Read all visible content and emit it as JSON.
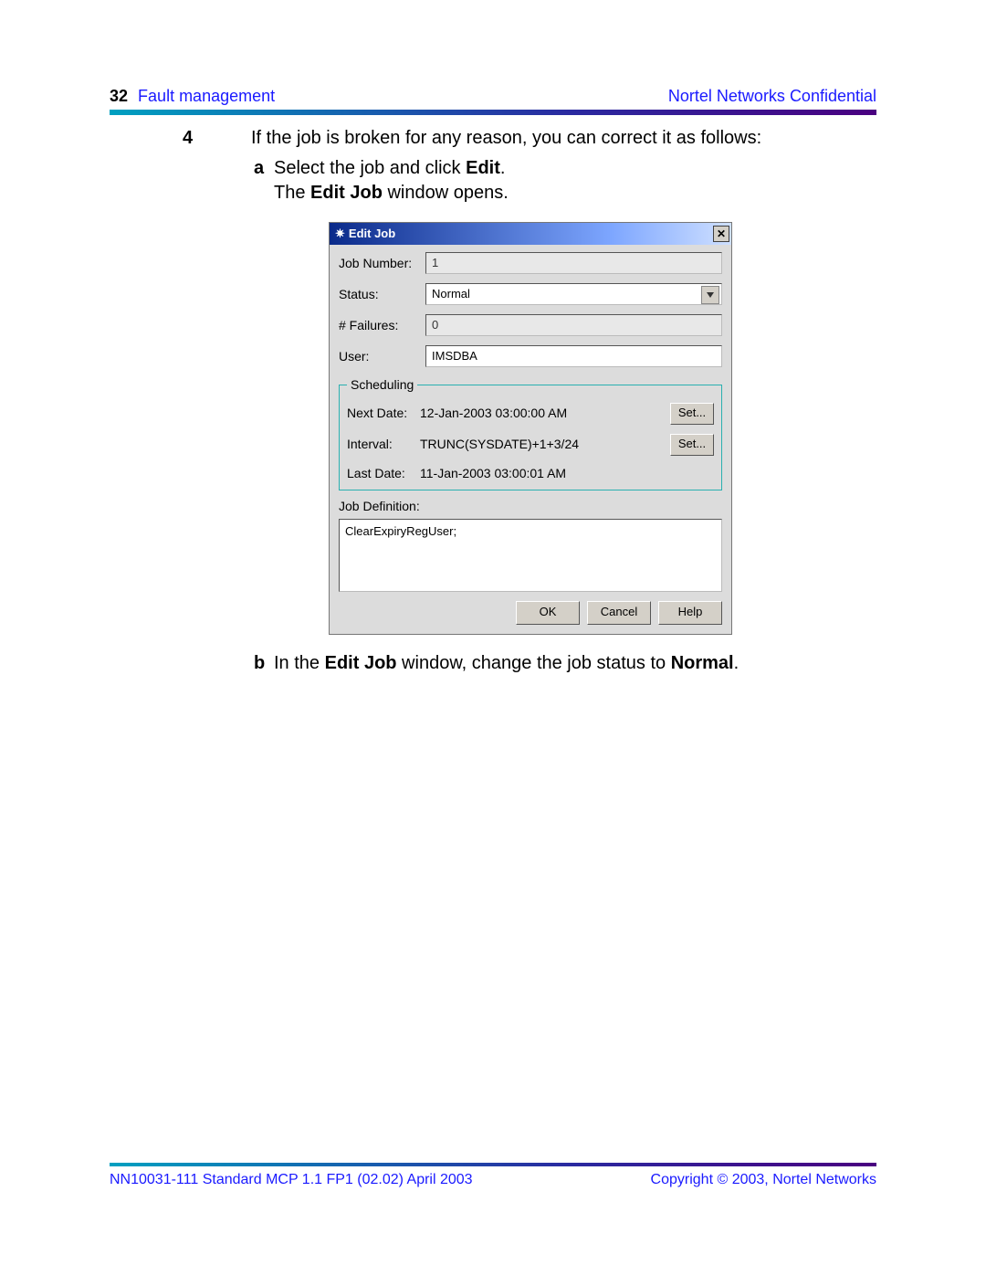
{
  "header": {
    "page_number": "32",
    "section": "Fault management",
    "confidential": "Nortel Networks Confidential"
  },
  "step": {
    "number": "4",
    "intro": "If the job is broken for any reason, you can correct it as follows:",
    "a_prefix": "a",
    "a_text_pre": "Select the job and click ",
    "a_bold": "Edit",
    "a_text_post": ".",
    "a_line2_pre": "The ",
    "a_line2_bold": "Edit Job",
    "a_line2_post": " window opens.",
    "b_prefix": "b",
    "b_text_pre": "In the ",
    "b_bold1": "Edit Job",
    "b_text_mid": " window, change the job status to ",
    "b_bold2": "Normal",
    "b_text_post": "."
  },
  "dialog": {
    "title": "Edit Job",
    "labels": {
      "job_number": "Job Number:",
      "status": "Status:",
      "failures": "# Failures:",
      "user": "User:",
      "scheduling": "Scheduling",
      "next_date": "Next Date:",
      "interval": "Interval:",
      "last_date": "Last Date:",
      "job_definition": "Job Definition:"
    },
    "values": {
      "job_number": "1",
      "status": "Normal",
      "failures": "0",
      "user": "IMSDBA",
      "next_date": "12-Jan-2003 03:00:00 AM",
      "interval": "TRUNC(SYSDATE)+1+3/24",
      "last_date": "11-Jan-2003 03:00:01 AM",
      "job_definition": "ClearExpiryRegUser;"
    },
    "buttons": {
      "set": "Set...",
      "ok": "OK",
      "cancel": "Cancel",
      "help": "Help"
    }
  },
  "footer": {
    "left": "NN10031-111   Standard   MCP 1.1 FP1 (02.02)   April 2003",
    "right": "Copyright © 2003, Nortel Networks"
  }
}
